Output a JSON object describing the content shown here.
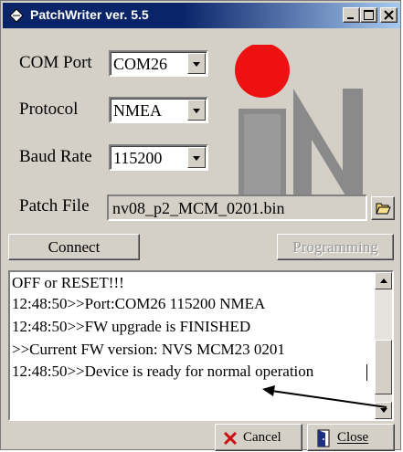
{
  "window": {
    "title": "PatchWriter ver. 5.5"
  },
  "form": {
    "com_port_label": "COM Port",
    "com_port_value": "COM26",
    "protocol_label": "Protocol",
    "protocol_value": "NMEA",
    "baud_rate_label": "Baud Rate",
    "baud_rate_value": "115200",
    "patch_file_label": "Patch File",
    "patch_file_value": "nv08_p2_MCM_0201.bin"
  },
  "buttons": {
    "connect": "Connect",
    "programming": "Programming",
    "cancel": "Cancel",
    "close": "Close"
  },
  "log": {
    "lines": [
      "OFF or RESET!!!",
      "12:48:50>>Port:COM26 115200 NMEA",
      "12:48:50>>FW upgrade is FINISHED",
      ">>Current FW version: NVS MCM23 0201",
      "12:48:50>>Device is ready for normal operation"
    ]
  },
  "colors": {
    "logo_red": "#ee1111",
    "logo_gray": "#8a8a8a",
    "title_bar": "#0a246a"
  }
}
